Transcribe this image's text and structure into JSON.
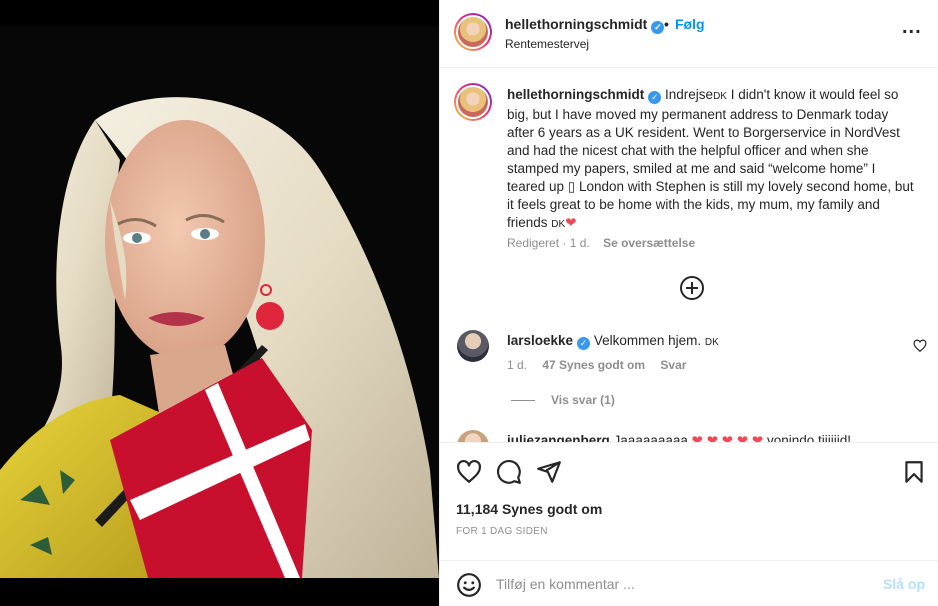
{
  "header": {
    "username": "hellethorningschmidt",
    "verified_mark": "✓",
    "separator": "•",
    "follow_label": "Følg",
    "location": "Rentemestervej",
    "more_icon": "more-dots",
    "more_glyph": "..."
  },
  "caption": {
    "username": "hellethorningschmidt",
    "text_part1": "Indrejse",
    "flag_label_1": "DK",
    "text_part2": " I didn't know it would feel so big, but I have moved my permanent address to Denmark today after 6 years as a UK resident. Went to Borgerservice in NordVest and had the nicest chat with the helpful officer and when she stamped my papers, smiled at me and said “welcome home” I teared up ",
    "unknown_glyph": "▯",
    "text_part3": " London with Stephen is still my lovely second home, but it feels great to be home with the kids, my mum, my family and friends ",
    "flag_label_2": "DK",
    "heart": "❤",
    "edited": "Redigeret",
    "dot": "·",
    "age": "1 d.",
    "translate": "Se oversættelse"
  },
  "load_more_icon": "plus-circle-icon",
  "comments": [
    {
      "username": "larsloekke",
      "verified_mark": "✓",
      "text": "Velkommen hjem.",
      "flag_label": "DK",
      "age": "1 d.",
      "likes": "47 Synes godt om",
      "reply": "Svar",
      "view_replies": "Vis svar (1)"
    },
    {
      "username": "juliezangenberg",
      "text_start": "Jaaaaaaaaa",
      "hearts": "❤ ❤ ❤ ❤ ❤",
      "text_end": " vonindo tiiiiiid!"
    }
  ],
  "actions": {
    "likes": "11,184 Synes godt om",
    "posted": "FOR 1 DAG SIDEN"
  },
  "comment_box": {
    "placeholder": "Tilføj en kommentar ...",
    "post_label": "Slå op"
  },
  "colors": {
    "link_blue": "#0095f6",
    "verified_blue": "#3897f0",
    "post_disabled": "#b2dffc",
    "heart_red": "#ed4956",
    "flag_red": "#c8102e"
  }
}
